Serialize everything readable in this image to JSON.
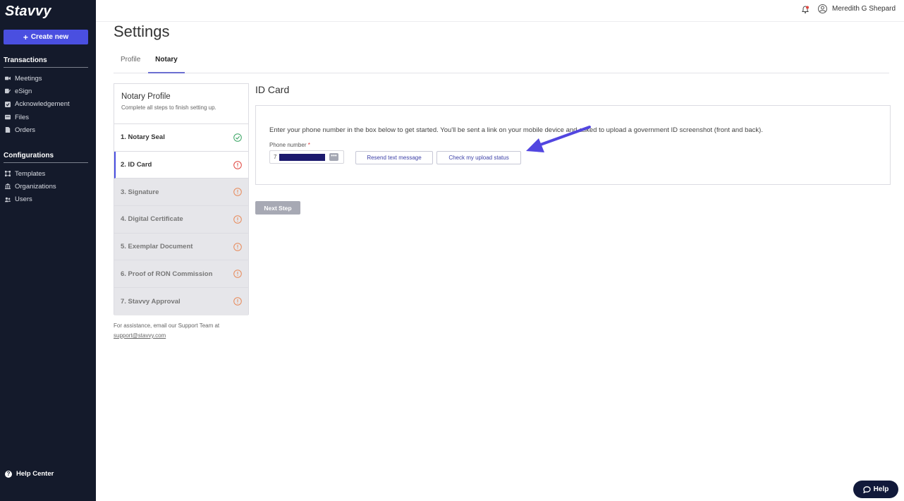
{
  "app": {
    "logo": "Stavvy"
  },
  "sidebar": {
    "create_label": "Create new",
    "sections": [
      {
        "title": "Transactions",
        "items": [
          {
            "label": "Meetings",
            "icon": "video-icon"
          },
          {
            "label": "eSign",
            "icon": "esign-icon"
          },
          {
            "label": "Acknowledgement",
            "icon": "check-box-icon"
          },
          {
            "label": "Files",
            "icon": "files-icon"
          },
          {
            "label": "Orders",
            "icon": "orders-icon"
          }
        ]
      },
      {
        "title": "Configurations",
        "items": [
          {
            "label": "Templates",
            "icon": "templates-icon"
          },
          {
            "label": "Organizations",
            "icon": "organizations-icon"
          },
          {
            "label": "Users",
            "icon": "users-icon"
          }
        ]
      }
    ],
    "help_center": "Help Center"
  },
  "topbar": {
    "user_name": "Meredith G Shepard"
  },
  "page": {
    "title": "Settings",
    "tabs": [
      {
        "label": "Profile"
      },
      {
        "label": "Notary"
      }
    ]
  },
  "steps_panel": {
    "title": "Notary Profile",
    "subtitle": "Complete all steps to finish setting up.",
    "steps": [
      {
        "label": "1. Notary Seal",
        "status": "complete"
      },
      {
        "label": "2. ID Card",
        "status": "incomplete"
      },
      {
        "label": "3. Signature",
        "status": "incomplete"
      },
      {
        "label": "4. Digital Certificate",
        "status": "incomplete"
      },
      {
        "label": "5. Exemplar Document",
        "status": "incomplete"
      },
      {
        "label": "6. Proof of RON Commission",
        "status": "incomplete"
      },
      {
        "label": "7. Stavvy Approval",
        "status": "incomplete"
      }
    ],
    "assist_text": "For assistance, email our Support Team at",
    "assist_email": "support@stavvy.com"
  },
  "id_card": {
    "title": "ID Card",
    "description": "Enter your phone number in the box below to get started. You'll be sent a link on your mobile device and asked to upload a government ID screenshot (front and back).",
    "phone_label": "Phone number",
    "phone_required": "*",
    "phone_value_prefix": "7",
    "phone_more": "•••",
    "resend_label": "Resend text message",
    "check_label": "Check my upload status",
    "next_label": "Next Step"
  },
  "help_widget": {
    "label": "Help"
  },
  "colors": {
    "sidebar_bg": "#141a2b",
    "accent": "#4a4fe0",
    "annotation_arrow": "#5246e0",
    "complete": "#3aa564",
    "incomplete": "#e0613e"
  }
}
